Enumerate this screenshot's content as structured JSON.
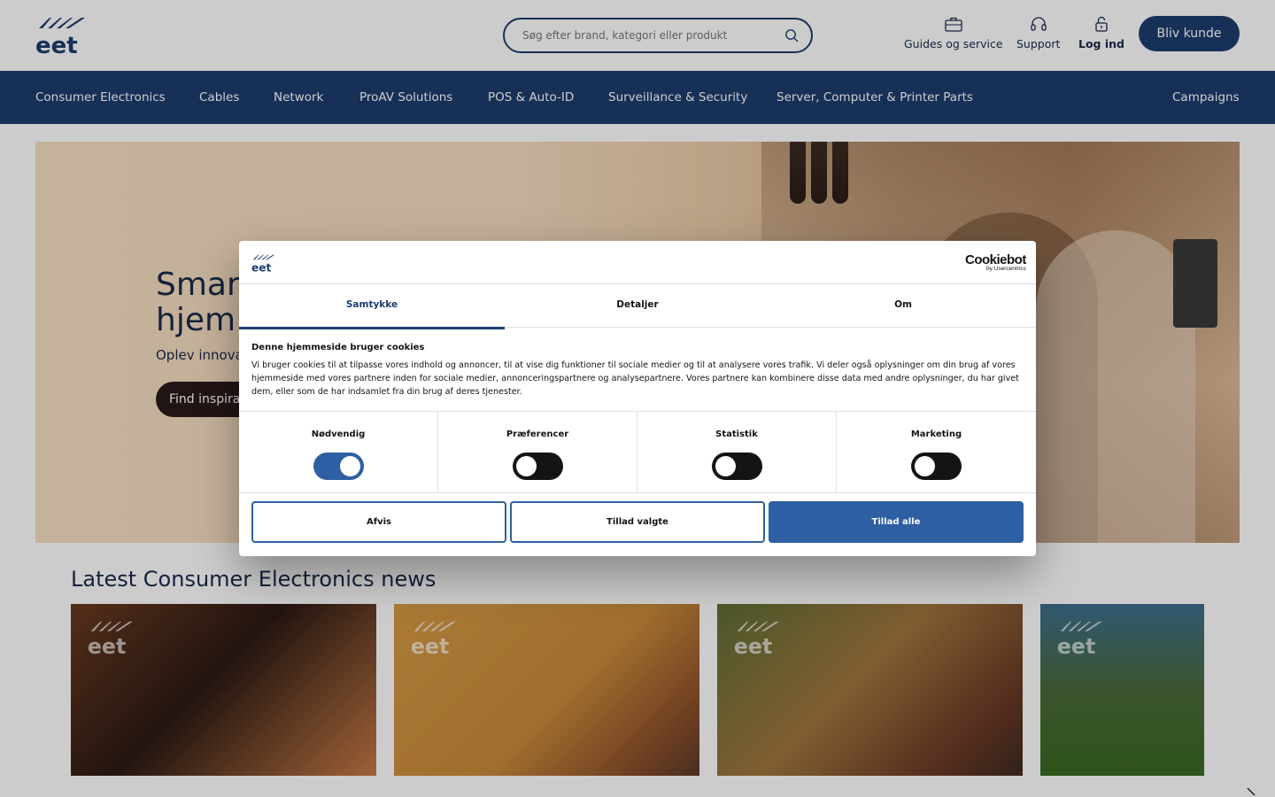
{
  "header": {
    "search_placeholder": "Søg efter brand, kategori eller produkt",
    "links": [
      {
        "label": "Guides og service",
        "icon": "briefcase-icon"
      },
      {
        "label": "Support",
        "icon": "headset-icon"
      },
      {
        "label": "Log ind",
        "icon": "lock-icon"
      }
    ],
    "cta_label": "Bliv kunde"
  },
  "nav": {
    "items": [
      "Consumer Electronics",
      "Cables",
      "Network",
      "ProAV Solutions",
      "POS & Auto-ID",
      "Surveillance & Security",
      "Server, Computer & Printer Parts",
      "Campaigns"
    ]
  },
  "hero": {
    "title_line1": "Smart",
    "title_line2": "hjem",
    "subtitle": "Oplev innova",
    "button_label": "Find inspira"
  },
  "news": {
    "title": "Latest Consumer Electronics news"
  },
  "cookie_dialog": {
    "brand_name": "Cookiebot",
    "brand_sub": "by Usercentrics",
    "tabs": [
      "Samtykke",
      "Detaljer",
      "Om"
    ],
    "active_tab": "Samtykke",
    "heading": "Denne hjemmeside bruger cookies",
    "body": "Vi bruger cookies til at tilpasse vores indhold og annoncer, til at vise dig funktioner til sociale medier og til at analysere vores trafik. Vi deler også oplysninger om din brug af vores hjemmeside med vores partnere inden for sociale medier, annonceringspartnere og analysepartnere. Vores partnere kan kombinere disse data med andre oplysninger, du har givet dem, eller som de har indsamlet fra din brug af deres tjenester.",
    "toggles": [
      {
        "label": "Nødvendig",
        "on": true
      },
      {
        "label": "Præferencer",
        "on": false
      },
      {
        "label": "Statistik",
        "on": false
      },
      {
        "label": "Marketing",
        "on": false
      }
    ],
    "buttons": {
      "reject": "Afvis",
      "allow_selected": "Tillad valgte",
      "allow_all": "Tillad alle"
    }
  },
  "colors": {
    "brand_navy": "#1d3d6e",
    "accent_blue": "#2f5fa3"
  }
}
